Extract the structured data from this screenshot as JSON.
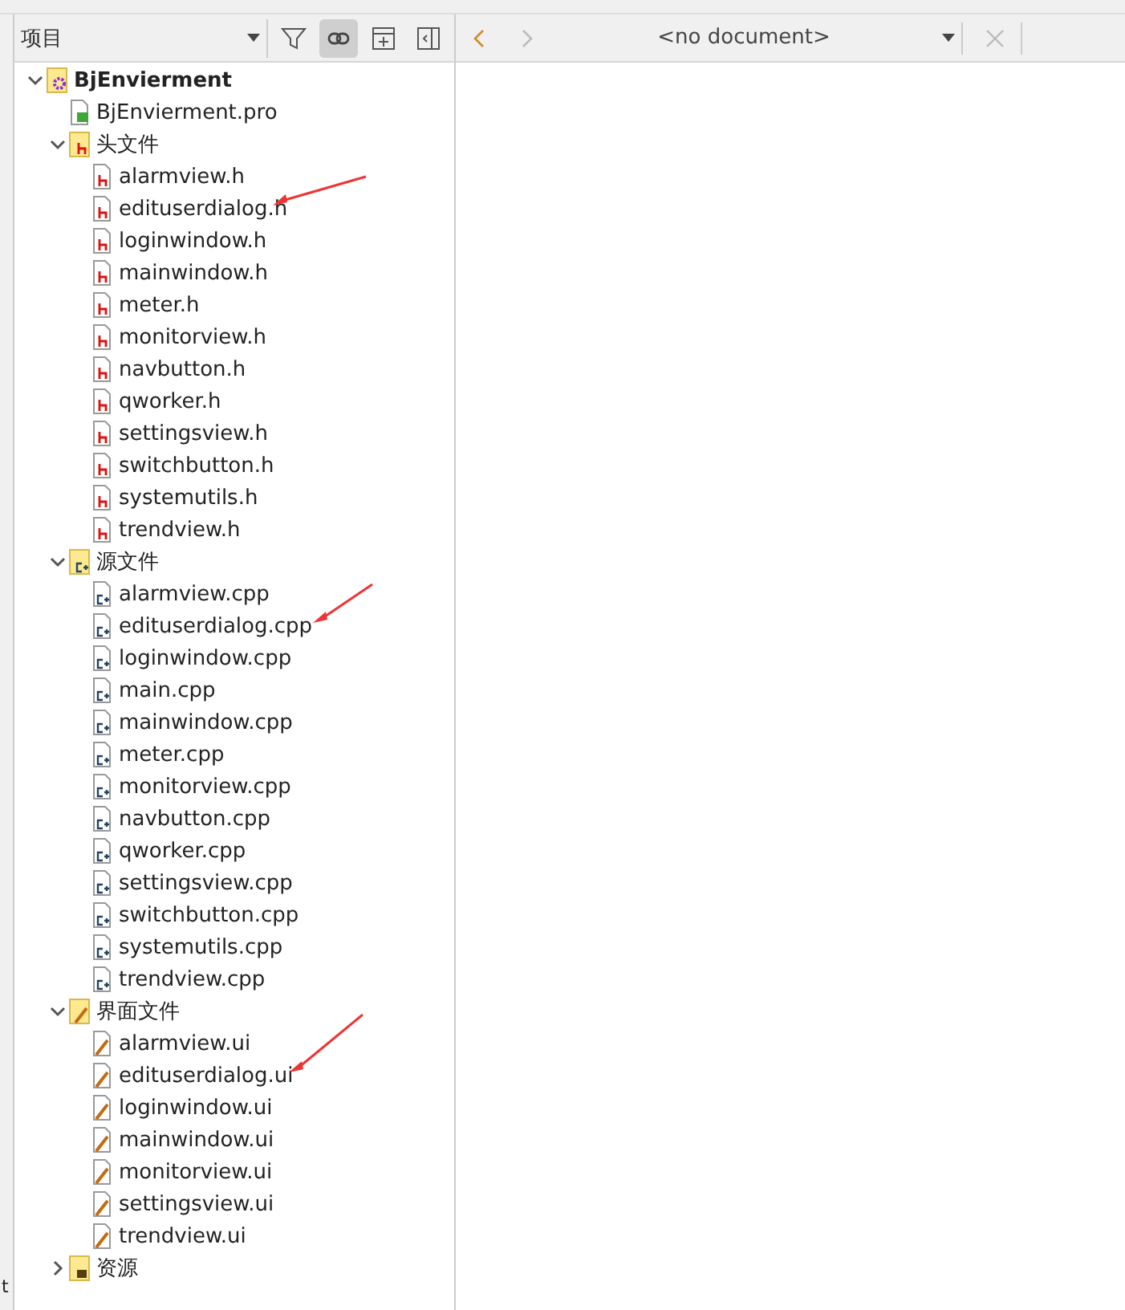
{
  "left_panel": {
    "view_selector": "项目",
    "link_toggle": {
      "selected": true
    }
  },
  "tree": [
    {
      "label": "BjEnvierment",
      "kind": "project",
      "expanded": true,
      "children": [
        {
          "label": "BjEnvierment.pro",
          "kind": "pro"
        },
        {
          "label": "头文件",
          "kind": "folder-h",
          "expanded": true,
          "children": [
            {
              "label": "alarmview.h",
              "kind": "h"
            },
            {
              "label": "edituserdialog.h",
              "kind": "h"
            },
            {
              "label": "loginwindow.h",
              "kind": "h"
            },
            {
              "label": "mainwindow.h",
              "kind": "h"
            },
            {
              "label": "meter.h",
              "kind": "h"
            },
            {
              "label": "monitorview.h",
              "kind": "h"
            },
            {
              "label": "navbutton.h",
              "kind": "h"
            },
            {
              "label": "qworker.h",
              "kind": "h"
            },
            {
              "label": "settingsview.h",
              "kind": "h"
            },
            {
              "label": "switchbutton.h",
              "kind": "h"
            },
            {
              "label": "systemutils.h",
              "kind": "h"
            },
            {
              "label": "trendview.h",
              "kind": "h"
            }
          ]
        },
        {
          "label": "源文件",
          "kind": "folder-cpp",
          "expanded": true,
          "children": [
            {
              "label": "alarmview.cpp",
              "kind": "cpp"
            },
            {
              "label": "edituserdialog.cpp",
              "kind": "cpp"
            },
            {
              "label": "loginwindow.cpp",
              "kind": "cpp"
            },
            {
              "label": "main.cpp",
              "kind": "cpp"
            },
            {
              "label": "mainwindow.cpp",
              "kind": "cpp"
            },
            {
              "label": "meter.cpp",
              "kind": "cpp"
            },
            {
              "label": "monitorview.cpp",
              "kind": "cpp"
            },
            {
              "label": "navbutton.cpp",
              "kind": "cpp"
            },
            {
              "label": "qworker.cpp",
              "kind": "cpp"
            },
            {
              "label": "settingsview.cpp",
              "kind": "cpp"
            },
            {
              "label": "switchbutton.cpp",
              "kind": "cpp"
            },
            {
              "label": "systemutils.cpp",
              "kind": "cpp"
            },
            {
              "label": "trendview.cpp",
              "kind": "cpp"
            }
          ]
        },
        {
          "label": "界面文件",
          "kind": "folder-ui",
          "expanded": true,
          "children": [
            {
              "label": "alarmview.ui",
              "kind": "ui"
            },
            {
              "label": "edituserdialog.ui",
              "kind": "ui"
            },
            {
              "label": "loginwindow.ui",
              "kind": "ui"
            },
            {
              "label": "mainwindow.ui",
              "kind": "ui"
            },
            {
              "label": "monitorview.ui",
              "kind": "ui"
            },
            {
              "label": "settingsview.ui",
              "kind": "ui"
            },
            {
              "label": "trendview.ui",
              "kind": "ui"
            }
          ]
        },
        {
          "label": "资源",
          "kind": "folder-res",
          "expanded": false
        }
      ]
    }
  ],
  "editor": {
    "document": "<no document>"
  },
  "edge_panel": {
    "text": "t"
  }
}
